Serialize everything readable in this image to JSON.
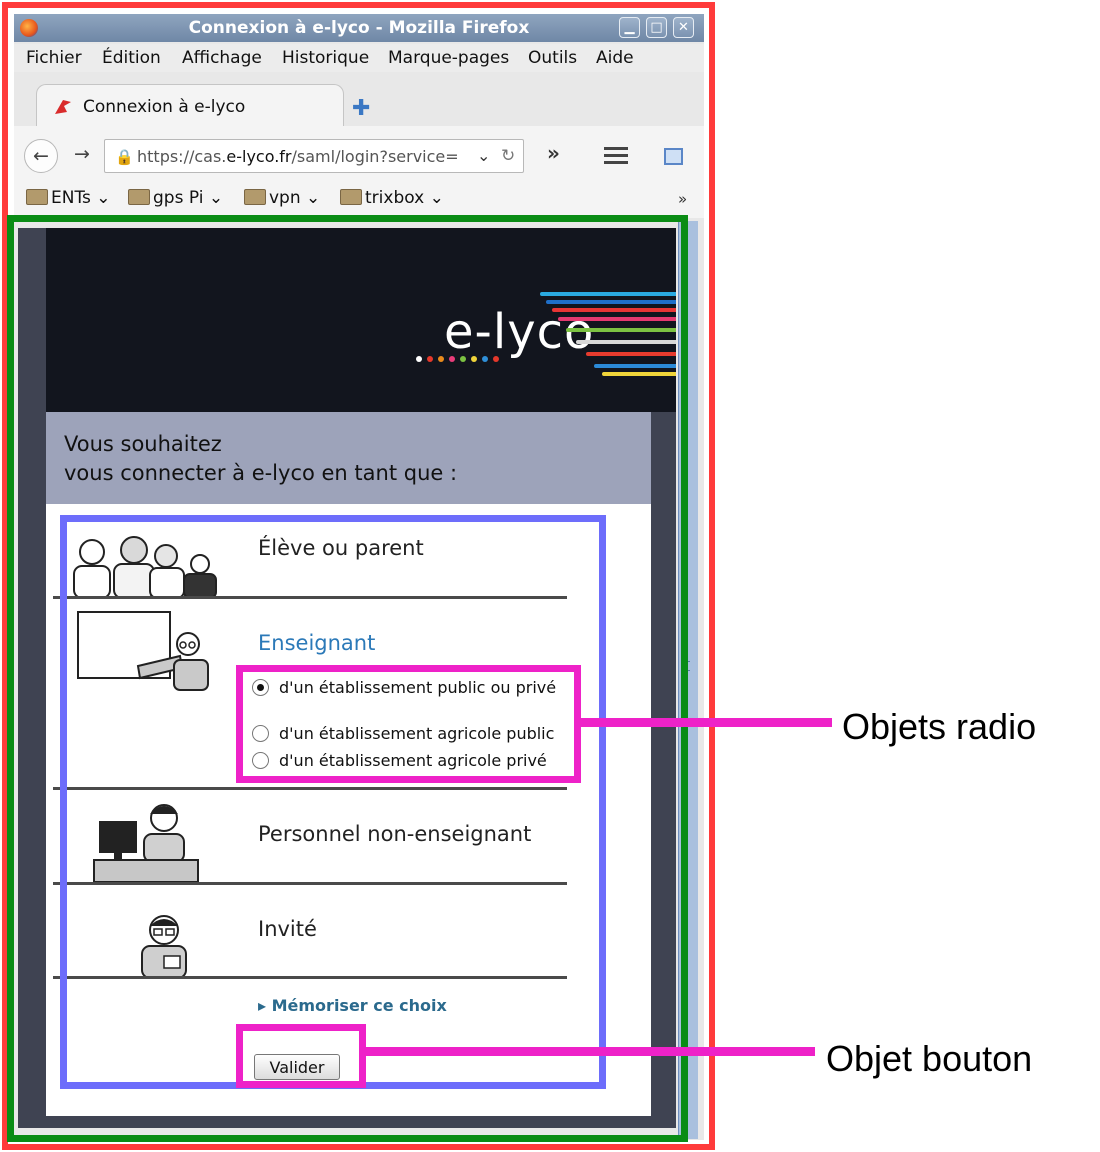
{
  "window": {
    "title": "Connexion à e-lyco - Mozilla Firefox"
  },
  "menu": [
    "Fichier",
    "Édition",
    "Affichage",
    "Historique",
    "Marque-pages",
    "Outils",
    "Aide"
  ],
  "tab": {
    "label": "Connexion à e-lyco"
  },
  "url": {
    "prefix": "https://cas.",
    "host": "e-lyco.fr",
    "path": "/saml/login?service="
  },
  "bookmarks": [
    "ENTs",
    "gps Pi",
    "vpn",
    "trixbox"
  ],
  "site": {
    "logo": "e-lyco",
    "prompt_line1": "Vous souhaitez",
    "prompt_line2": "vous connecter à e-lyco en tant que :",
    "options": [
      {
        "label": "Élève ou parent",
        "icon": "students-parents-icon"
      },
      {
        "label": "Enseignant",
        "icon": "teacher-icon"
      },
      {
        "label": "Personnel non-enseignant",
        "icon": "staff-icon"
      },
      {
        "label": "Invité",
        "icon": "guest-icon"
      }
    ],
    "radios": [
      {
        "label": "d'un établissement public ou privé",
        "checked": true
      },
      {
        "label": "d'un établissement agricole public",
        "checked": false
      },
      {
        "label": "d'un établissement agricole privé",
        "checked": false
      }
    ],
    "remember": "Mémoriser ce choix",
    "submit": "Valider"
  },
  "annotations": {
    "radio": "Objets radio",
    "button": "Objet bouton"
  },
  "colors": {
    "outer_frame": "#ff3b3b",
    "browser_content_frame": "#0a8c15",
    "form_frame": "#6d6dfb",
    "highlight": "#ee22c8",
    "enseignant_active": "#2b79b8"
  }
}
